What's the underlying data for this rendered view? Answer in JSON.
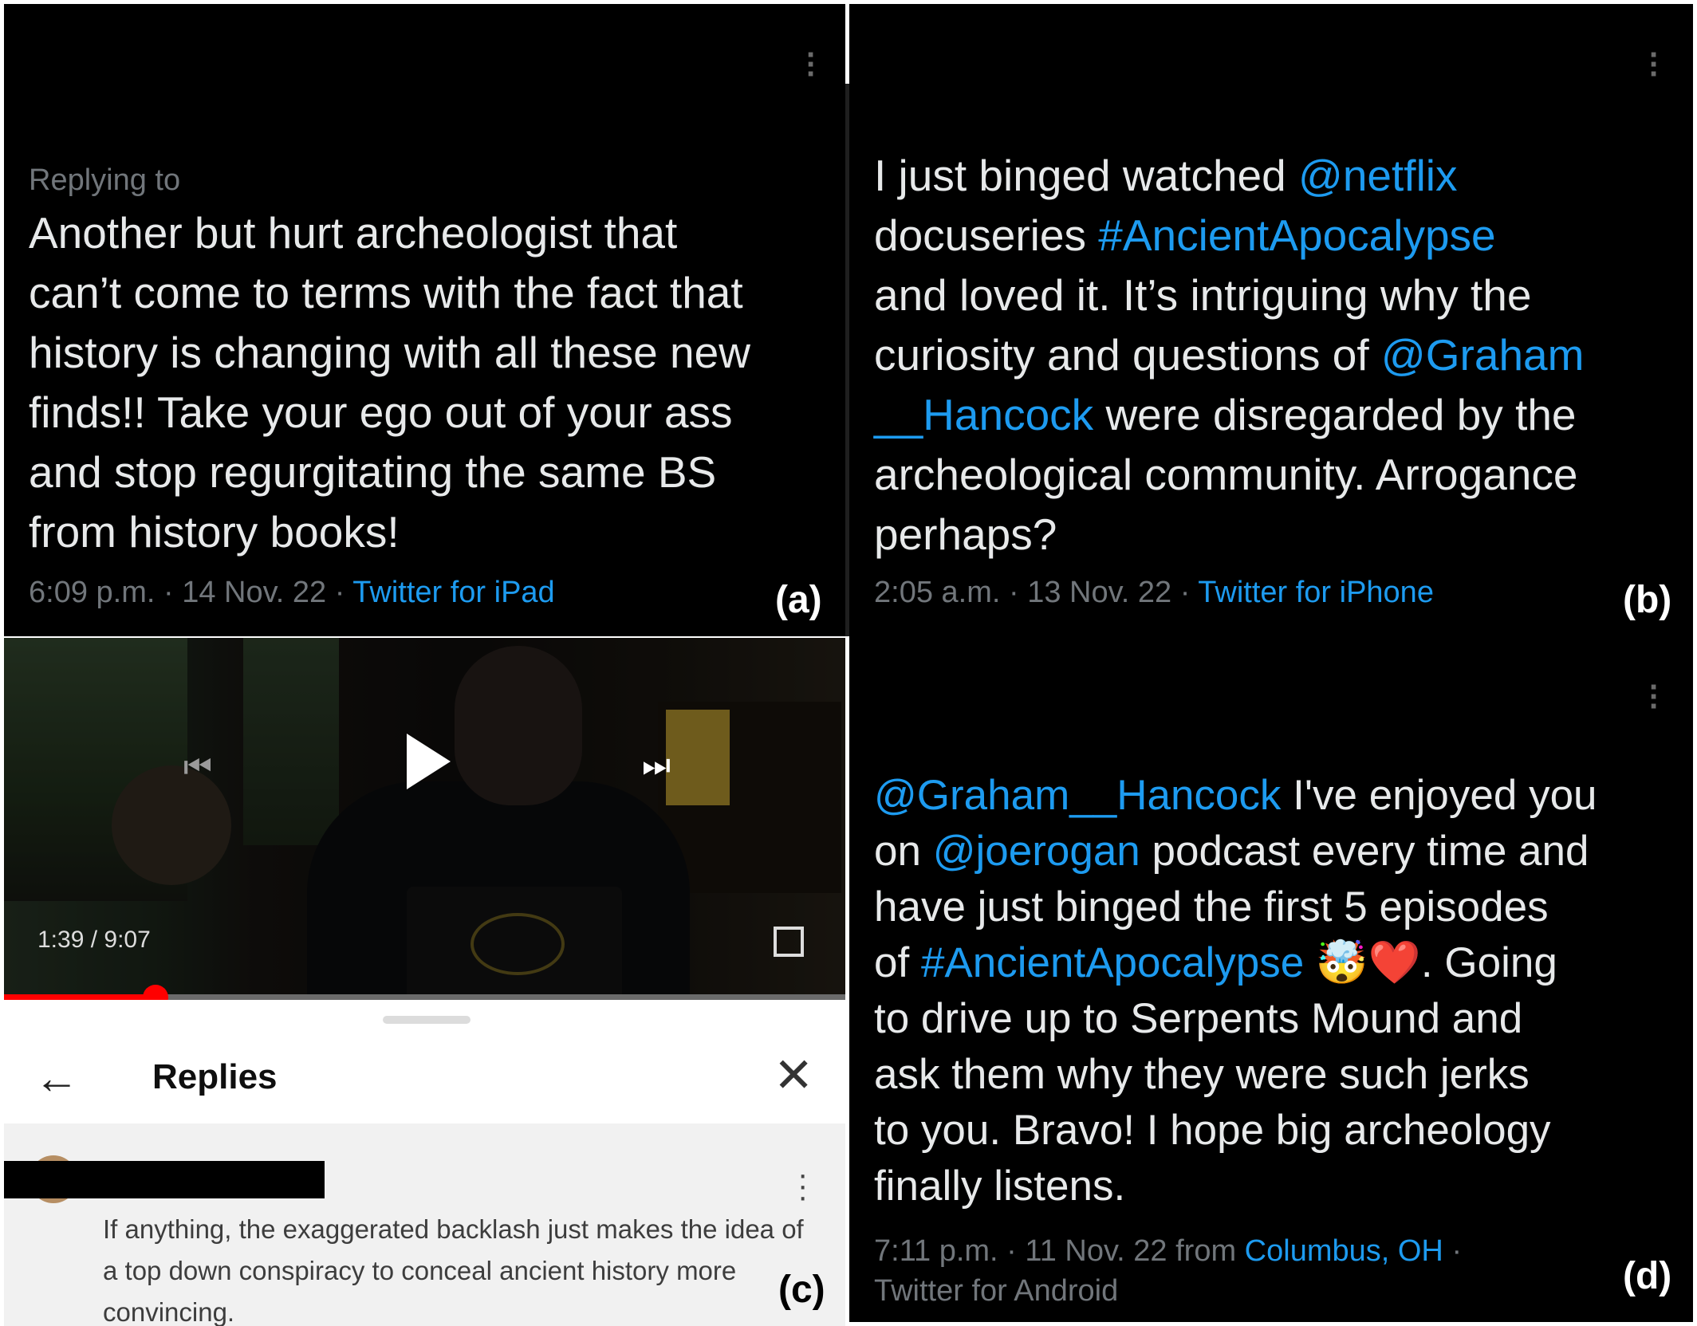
{
  "panel_a": {
    "replying_to": "Replying to",
    "text": "Another but hurt archeologist that\ncan’t come to terms with the fact that\nhistory is changing with all these new\nfinds!!  Take your ego out of your ass\nand stop regurgitating the same BS\nfrom history books!",
    "time": "6:09 p.m.",
    "sep1": "·",
    "date": "14 Nov. 22",
    "sep2": "·",
    "source": "Twitter for iPad",
    "label": "(a)"
  },
  "panel_b": {
    "t1": "I just binged watched ",
    "l1": "@netflix",
    "t2": "\ndocuseries ",
    "l2": "#AncientApocalypse",
    "t3": "\nand loved it. It’s intriguing why the\ncuriosity and questions of ",
    "l3": "@Graham\n__Hancock",
    "t4": " were disregarded by the\narcheological community. Arrogance\nperhaps?",
    "time": "2:05 a.m.",
    "sep1": "·",
    "date": "13 Nov. 22",
    "sep2": "·",
    "source": "Twitter for iPhone",
    "label": "(b)"
  },
  "panel_c": {
    "timecode": "1:39 / 9:07",
    "progress_fraction": 0.18,
    "sheet_title": "Replies",
    "reply_text": "If anything, the exaggerated backlash just makes the idea of a top down conspiracy to conceal ancient history more convincing.",
    "label": "(c)"
  },
  "panel_d": {
    "l1": "@Graham__Hancock",
    "t1": " I've enjoyed you\non ",
    "l2": "@joerogan",
    "t2": " podcast every time and\nhave just binged the first 5 episodes\nof ",
    "l3": "#AncientApocalypse",
    "emoji": " 🤯❤️",
    "t3": ". Going\nto drive up to Serpents Mound and\nask them why they were such jerks\nto you. Bravo! I hope big archeology\nfinally listens.",
    "time": "7:11 p.m.",
    "sep1": "·",
    "date": "11 Nov. 22",
    "from": "from",
    "location": "Columbus, OH",
    "sep2": "·",
    "source": "Twitter for Android",
    "label": "(d)"
  },
  "colors": {
    "link": "#1d9bf0",
    "text": "#e7e9ea",
    "meta": "#71767b",
    "progress": "#ff0000"
  }
}
